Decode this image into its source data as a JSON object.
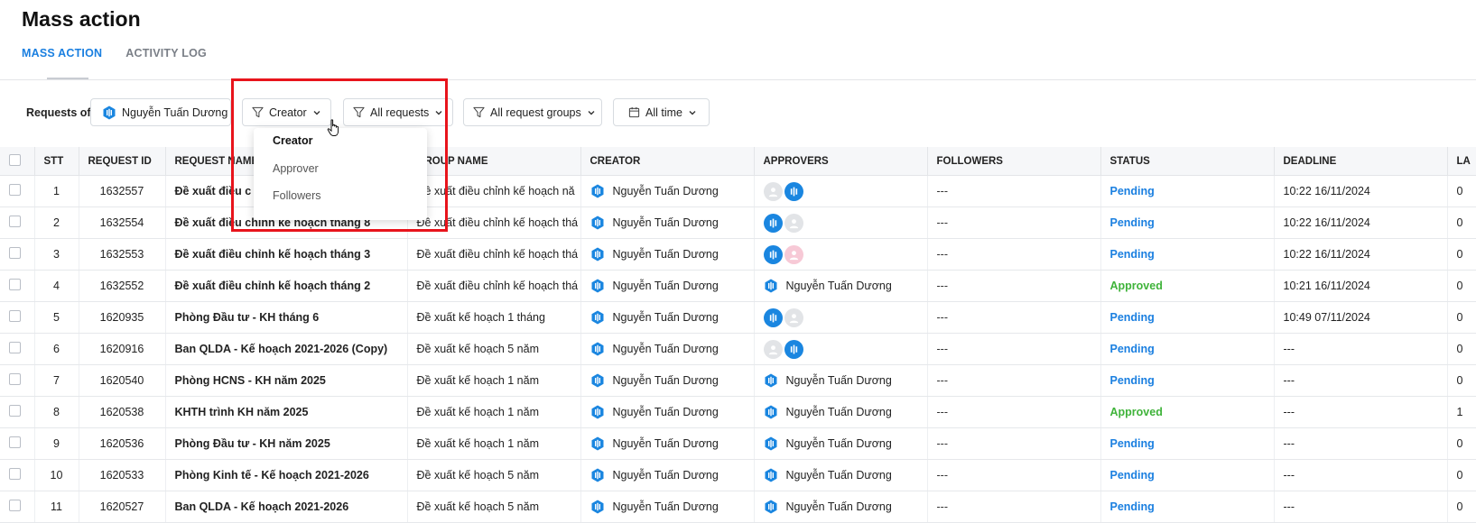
{
  "page": {
    "title": "Mass action",
    "tabs": [
      {
        "label": "MASS ACTION",
        "active": true
      },
      {
        "label": "ACTIVITY LOG",
        "active": false
      }
    ]
  },
  "filters": {
    "requests_of_label": "Requests of:",
    "user": "Nguyễn Tuấn Dương",
    "creator": "Creator",
    "all_requests": "All requests",
    "all_request_groups": "All request groups",
    "all_time": "All time"
  },
  "dropdown": {
    "items": [
      "Creator",
      "Approver",
      "Followers"
    ],
    "selected": "Creator"
  },
  "table": {
    "columns": [
      "STT",
      "REQUEST ID",
      "REQUEST NAME",
      "GROUP NAME",
      "CREATOR",
      "APPROVERS",
      "FOLLOWERS",
      "STATUS",
      "DEADLINE",
      "LA"
    ],
    "rows": [
      {
        "stt": "1",
        "id": "1632557",
        "name": "Đề xuất điều c",
        "group": "Đề xuất điều chỉnh kế hoạch nă",
        "creator": "Nguyễn Tuấn Dương",
        "approvers": [
          "grey",
          "logo"
        ],
        "followers": "---",
        "status": "Pending",
        "deadline": "10:22 16/11/2024",
        "last": "0"
      },
      {
        "stt": "2",
        "id": "1632554",
        "name": "Đề xuất điều chỉnh kế hoạch tháng 8",
        "group": "Đề xuất điều chỉnh kế hoạch thá",
        "creator": "Nguyễn Tuấn Dương",
        "approvers": [
          "logo",
          "grey"
        ],
        "followers": "---",
        "status": "Pending",
        "deadline": "10:22 16/11/2024",
        "last": "0"
      },
      {
        "stt": "3",
        "id": "1632553",
        "name": "Đề xuất điều chỉnh kế hoạch tháng 3",
        "group": "Đề xuất điều chỉnh kế hoạch thá",
        "creator": "Nguyễn Tuấn Dương",
        "approvers": [
          "logo",
          "pink"
        ],
        "followers": "---",
        "status": "Pending",
        "deadline": "10:22 16/11/2024",
        "last": "0"
      },
      {
        "stt": "4",
        "id": "1632552",
        "name": "Đề xuất điều chỉnh kế hoạch tháng 2",
        "group": "Đề xuất điều chỉnh kế hoạch thá",
        "creator": "Nguyễn Tuấn Dương",
        "approver_name": "Nguyễn Tuấn Dương",
        "followers": "---",
        "status": "Approved",
        "deadline": "10:21 16/11/2024",
        "last": "0"
      },
      {
        "stt": "5",
        "id": "1620935",
        "name": "Phòng Đầu tư - KH tháng 6",
        "group": "Đề xuất kế hoạch 1 tháng",
        "creator": "Nguyễn Tuấn Dương",
        "approvers": [
          "logo",
          "grey"
        ],
        "followers": "---",
        "status": "Pending",
        "deadline": "10:49 07/11/2024",
        "last": "0"
      },
      {
        "stt": "6",
        "id": "1620916",
        "name": "Ban QLDA - Kế hoạch 2021-2026 (Copy)",
        "group": "Đề xuất kế hoạch 5 năm",
        "creator": "Nguyễn Tuấn Dương",
        "approvers": [
          "grey",
          "logo"
        ],
        "followers": "---",
        "status": "Pending",
        "deadline": "---",
        "last": "0"
      },
      {
        "stt": "7",
        "id": "1620540",
        "name": "Phòng HCNS - KH năm 2025",
        "group": "Đề xuất kế hoạch 1 năm",
        "creator": "Nguyễn Tuấn Dương",
        "approver_name": "Nguyễn Tuấn Dương",
        "followers": "---",
        "status": "Pending",
        "deadline": "---",
        "last": "0"
      },
      {
        "stt": "8",
        "id": "1620538",
        "name": "KHTH trình KH năm 2025",
        "group": "Đề xuất kế hoạch 1 năm",
        "creator": "Nguyễn Tuấn Dương",
        "approver_name": "Nguyễn Tuấn Dương",
        "followers": "---",
        "status": "Approved",
        "deadline": "---",
        "last": "1"
      },
      {
        "stt": "9",
        "id": "1620536",
        "name": "Phòng Đầu tư - KH năm 2025",
        "group": "Đề xuất kế hoạch 1 năm",
        "creator": "Nguyễn Tuấn Dương",
        "approver_name": "Nguyễn Tuấn Dương",
        "followers": "---",
        "status": "Pending",
        "deadline": "---",
        "last": "0"
      },
      {
        "stt": "10",
        "id": "1620533",
        "name": "Phòng Kinh tế - Kế hoạch 2021-2026",
        "group": "Đề xuất kế hoạch 5 năm",
        "creator": "Nguyễn Tuấn Dương",
        "approver_name": "Nguyễn Tuấn Dương",
        "followers": "---",
        "status": "Pending",
        "deadline": "---",
        "last": "0"
      },
      {
        "stt": "11",
        "id": "1620527",
        "name": "Ban QLDA - Kế hoạch 2021-2026",
        "group": "Đề xuất kế hoạch 5 năm",
        "creator": "Nguyễn Tuấn Dương",
        "approver_name": "Nguyễn Tuấn Dương",
        "followers": "---",
        "status": "Pending",
        "deadline": "---",
        "last": "0"
      }
    ]
  },
  "colors": {
    "accent": "#1a7fe0",
    "approved": "#3fb33a",
    "highlight_box": "#e8141c"
  }
}
